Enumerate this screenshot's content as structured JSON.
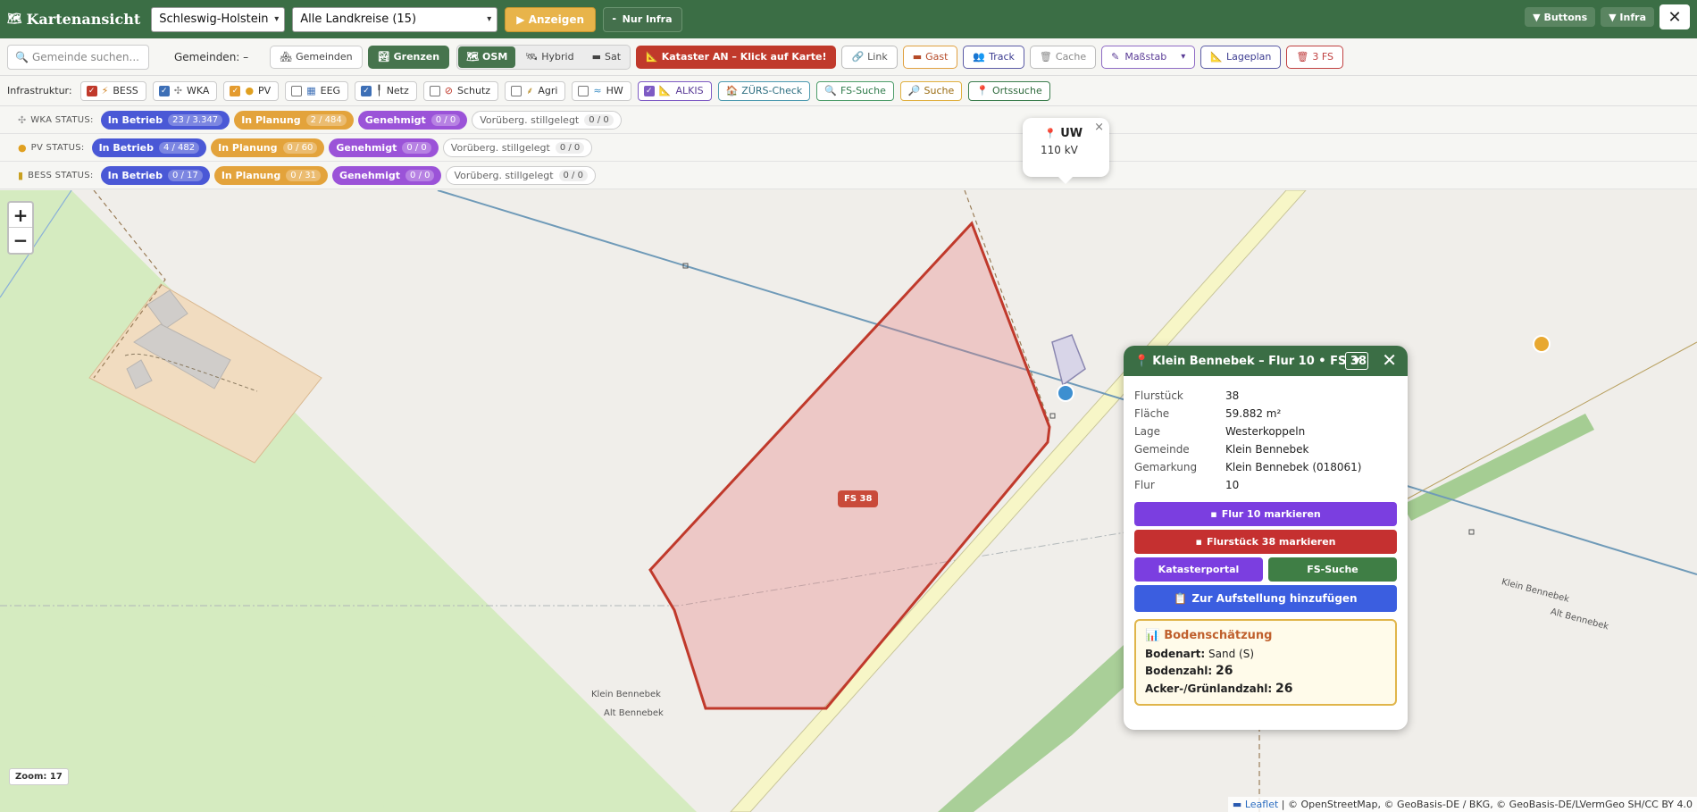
{
  "topbar": {
    "title": "Kartenansicht",
    "state_select": "Schleswig-Holstein",
    "district_select": "Alle Landkreise (15)",
    "show_button": "▶ Anzeigen",
    "infra_only_button": "Nur Infra",
    "buttons_toggle": "▼ Buttons",
    "infra_toggle": "▼ Infra",
    "close": "✕"
  },
  "toolbar": {
    "search_placeholder": "Gemeinde suchen...",
    "gemeinden_count": "Gemeinden: –",
    "gemeinden_btn": "Gemeinden",
    "grenzen_btn": "Grenzen",
    "layers": [
      "OSM",
      "Hybrid",
      "Sat"
    ],
    "active_layer": "OSM",
    "kataster_btn": "Kataster AN – Klick auf Karte!",
    "link_btn": "Link",
    "gast_btn": "Gast",
    "track_btn": "Track",
    "cache_btn": "Cache",
    "massstab_select": "Maßstab",
    "lageplan_btn": "Lageplan",
    "fs_btn": "3 FS"
  },
  "infra": {
    "label": "Infrastruktur:",
    "items": [
      {
        "label": "BESS",
        "checked": true
      },
      {
        "label": "WKA",
        "checked": true
      },
      {
        "label": "PV",
        "checked": true
      },
      {
        "label": "EEG",
        "checked": false
      },
      {
        "label": "Netz",
        "checked": true
      },
      {
        "label": "Schutz",
        "checked": false
      },
      {
        "label": "Agri",
        "checked": false
      },
      {
        "label": "HW",
        "checked": false
      },
      {
        "label": "ALKIS",
        "checked": true
      }
    ],
    "zuers_btn": "ZÜRS-Check",
    "fs_suche_btn": "FS-Suche",
    "suche_btn": "Suche",
    "ortssuche_btn": "Ortssuche"
  },
  "status": {
    "wka": {
      "label": "WKA STATUS:",
      "in_betrieb": "In Betrieb",
      "in_betrieb_cnt": "23 / 3.347",
      "in_planung": "In Planung",
      "in_planung_cnt": "2 / 484",
      "genehmigt": "Genehmigt",
      "genehmigt_cnt": "0 / 0",
      "stillgelegt": "Vorüberg. stillgelegt",
      "stillgelegt_cnt": "0 / 0"
    },
    "pv": {
      "label": "PV STATUS:",
      "in_betrieb": "In Betrieb",
      "in_betrieb_cnt": "4 / 482",
      "in_planung": "In Planung",
      "in_planung_cnt": "0 / 60",
      "genehmigt": "Genehmigt",
      "genehmigt_cnt": "0 / 0",
      "stillgelegt": "Vorüberg. stillgelegt",
      "stillgelegt_cnt": "0 / 0"
    },
    "bess": {
      "label": "BESS STATUS:",
      "in_betrieb": "In Betrieb",
      "in_betrieb_cnt": "0 / 17",
      "in_planung": "In Planung",
      "in_planung_cnt": "0 / 31",
      "genehmigt": "Genehmigt",
      "genehmigt_cnt": "0 / 0",
      "stillgelegt": "Vorüberg. stillgelegt",
      "stillgelegt_cnt": "0 / 0"
    }
  },
  "map": {
    "zoom_in": "+",
    "zoom_out": "−",
    "zoom_label": "Zoom: 17",
    "fs_label": "FS 38",
    "place_labels": [
      "Klein Bennebek",
      "Alt Bennebek",
      "Klein Bennebek",
      "Alt Bennebek"
    ],
    "attribution_link": "Leaflet",
    "attribution_text": "| © OpenStreetMap, © GeoBasis-DE / BKG, © GeoBasis-DE/LVermGeo SH/CC BY 4.0"
  },
  "uw_popup": {
    "title": "UW",
    "voltage": "110 kV",
    "close": "×"
  },
  "parcel_panel": {
    "title": "Klein Bennebek – Flur 10 • FS 38",
    "filter_btn": "▼",
    "close": "✕",
    "props": [
      {
        "k": "Flurstück",
        "v": "38"
      },
      {
        "k": "Fläche",
        "v": "59.882 m²"
      },
      {
        "k": "Lage",
        "v": "Westerkoppeln"
      },
      {
        "k": "Gemeinde",
        "v": "Klein Bennebek"
      },
      {
        "k": "Gemarkung",
        "v": "Klein Bennebek (018061)"
      },
      {
        "k": "Flur",
        "v": "10"
      }
    ],
    "btn_flur": "Flur 10 markieren",
    "btn_flurstueck": "Flurstück 38 markieren",
    "btn_katasterportal": "Katasterportal",
    "btn_fs_suche": "FS-Suche",
    "btn_aufstellung": "Zur Aufstellung hinzufügen",
    "boden": {
      "title": "Bodenschätzung",
      "bodenart_label": "Bodenart:",
      "bodenart_value": "Sand (S)",
      "bodenzahl_label": "Bodenzahl:",
      "bodenzahl_value": "26",
      "acker_label": "Acker-/Grünlandzahl:",
      "acker_value": "26"
    }
  },
  "colors": {
    "header_green": "#3b6e45",
    "parcel_red": "#c0392b",
    "status_blue": "#4a58d6",
    "status_amber": "#e3a33b",
    "status_violet": "#9b53d8"
  }
}
